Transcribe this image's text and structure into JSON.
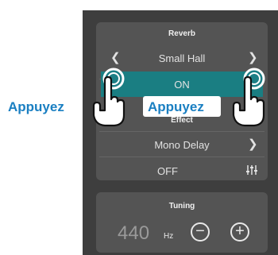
{
  "reverb": {
    "title": "Reverb",
    "type": "Small Hall",
    "state": "ON"
  },
  "effect": {
    "title": "Effect",
    "type": "Mono Delay",
    "state": "OFF"
  },
  "tuning": {
    "title": "Tuning",
    "value": "440",
    "unit": "Hz"
  },
  "callouts": {
    "left": "Appuyez",
    "right": "Appuyez"
  },
  "icons": [
    "chevron-left-icon",
    "chevron-right-icon",
    "settings-sliders-icon",
    "minus-icon",
    "plus-icon",
    "hand-pointer-icon"
  ],
  "colors": {
    "on_highlight": "#1a7e82",
    "callout_text": "#1a7fc2",
    "panel": "#545454",
    "background": "#3e3e3e"
  }
}
